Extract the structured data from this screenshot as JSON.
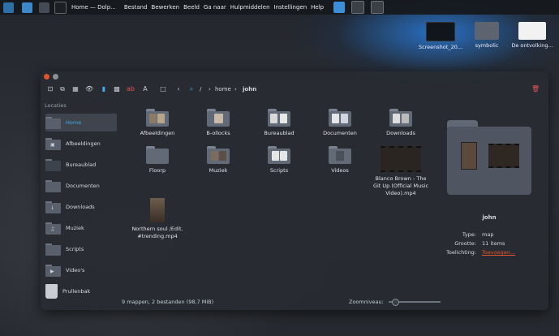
{
  "panel": {
    "task_title": "Home — Dolp...",
    "menu": [
      "Bestand",
      "Bewerken",
      "Beeld",
      "Ga naar",
      "Hulpmiddelen",
      "Instellingen",
      "Help"
    ]
  },
  "desktop": {
    "icons": [
      {
        "label": "Screenshot_20..."
      },
      {
        "label": "symbolic"
      },
      {
        "label": "De ontvolking..."
      }
    ]
  },
  "breadcrumb": {
    "sep1": "/",
    "home": "home",
    "user": "john"
  },
  "sidebar": {
    "section_label": "Locaties",
    "items": [
      {
        "label": "Home",
        "icon": "home-folder-icon"
      },
      {
        "label": "Afbeeldingen",
        "icon": "image-folder-icon"
      },
      {
        "label": "Bureaublad",
        "icon": "desktop-folder-icon"
      },
      {
        "label": "Documenten",
        "icon": "documents-folder-icon"
      },
      {
        "label": "Downloads",
        "icon": "download-folder-icon"
      },
      {
        "label": "Muziek",
        "icon": "music-folder-icon"
      },
      {
        "label": "Scripts",
        "icon": "scripts-folder-icon"
      },
      {
        "label": "Video's",
        "icon": "video-folder-icon"
      },
      {
        "label": "Prullenbak",
        "icon": "trash-icon"
      }
    ]
  },
  "files": [
    {
      "label": "Afbeeldingen"
    },
    {
      "label": "B-ollocks"
    },
    {
      "label": "Bureaublad"
    },
    {
      "label": "Documenten"
    },
    {
      "label": "Downloads"
    },
    {
      "label": "Floorp"
    },
    {
      "label": "Muziek"
    },
    {
      "label": "Scripts"
    },
    {
      "label": "Videos"
    },
    {
      "label": "Blanco Brown - The Git Up (Official Music Video).mp4"
    },
    {
      "label": "Northern soul /Edit. #trending.mp4"
    }
  ],
  "info": {
    "name": "john",
    "type_label": "Type:",
    "type_value": "map",
    "size_label": "Grootte:",
    "size_value": "11 items",
    "comment_label": "Toelichting:",
    "comment_link": "Toevoegen..."
  },
  "status": {
    "summary": "9 mappen, 2 bestanden (98,7 MiB)",
    "zoom_label": "Zoomniveau:"
  },
  "colors": {
    "accent": "#3daee9",
    "close": "#e0552d",
    "link": "#e0552d",
    "danger": "#e05555"
  }
}
